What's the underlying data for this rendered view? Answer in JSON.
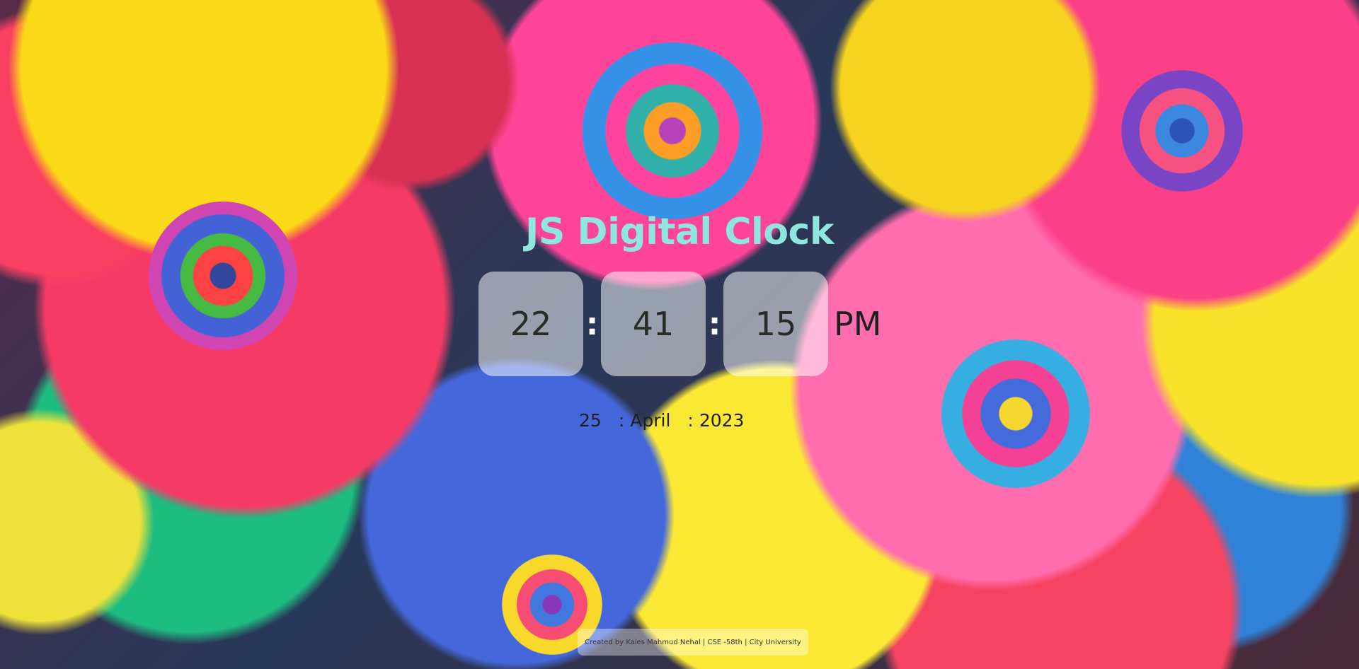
{
  "page": {
    "title": "JS Digital Clock",
    "title_color": "#8fe6df"
  },
  "clock": {
    "hours": "22",
    "minutes": "41",
    "seconds": "15",
    "separator": ":",
    "ampm": "PM"
  },
  "date": {
    "day": "25",
    "month": "April",
    "year": "2023",
    "separator": ":"
  },
  "footer": {
    "credit": "Created by Kaies Mahmud Nehal | CSE -58th | City University"
  },
  "background": {
    "icon": "rose-bouquet-image"
  }
}
